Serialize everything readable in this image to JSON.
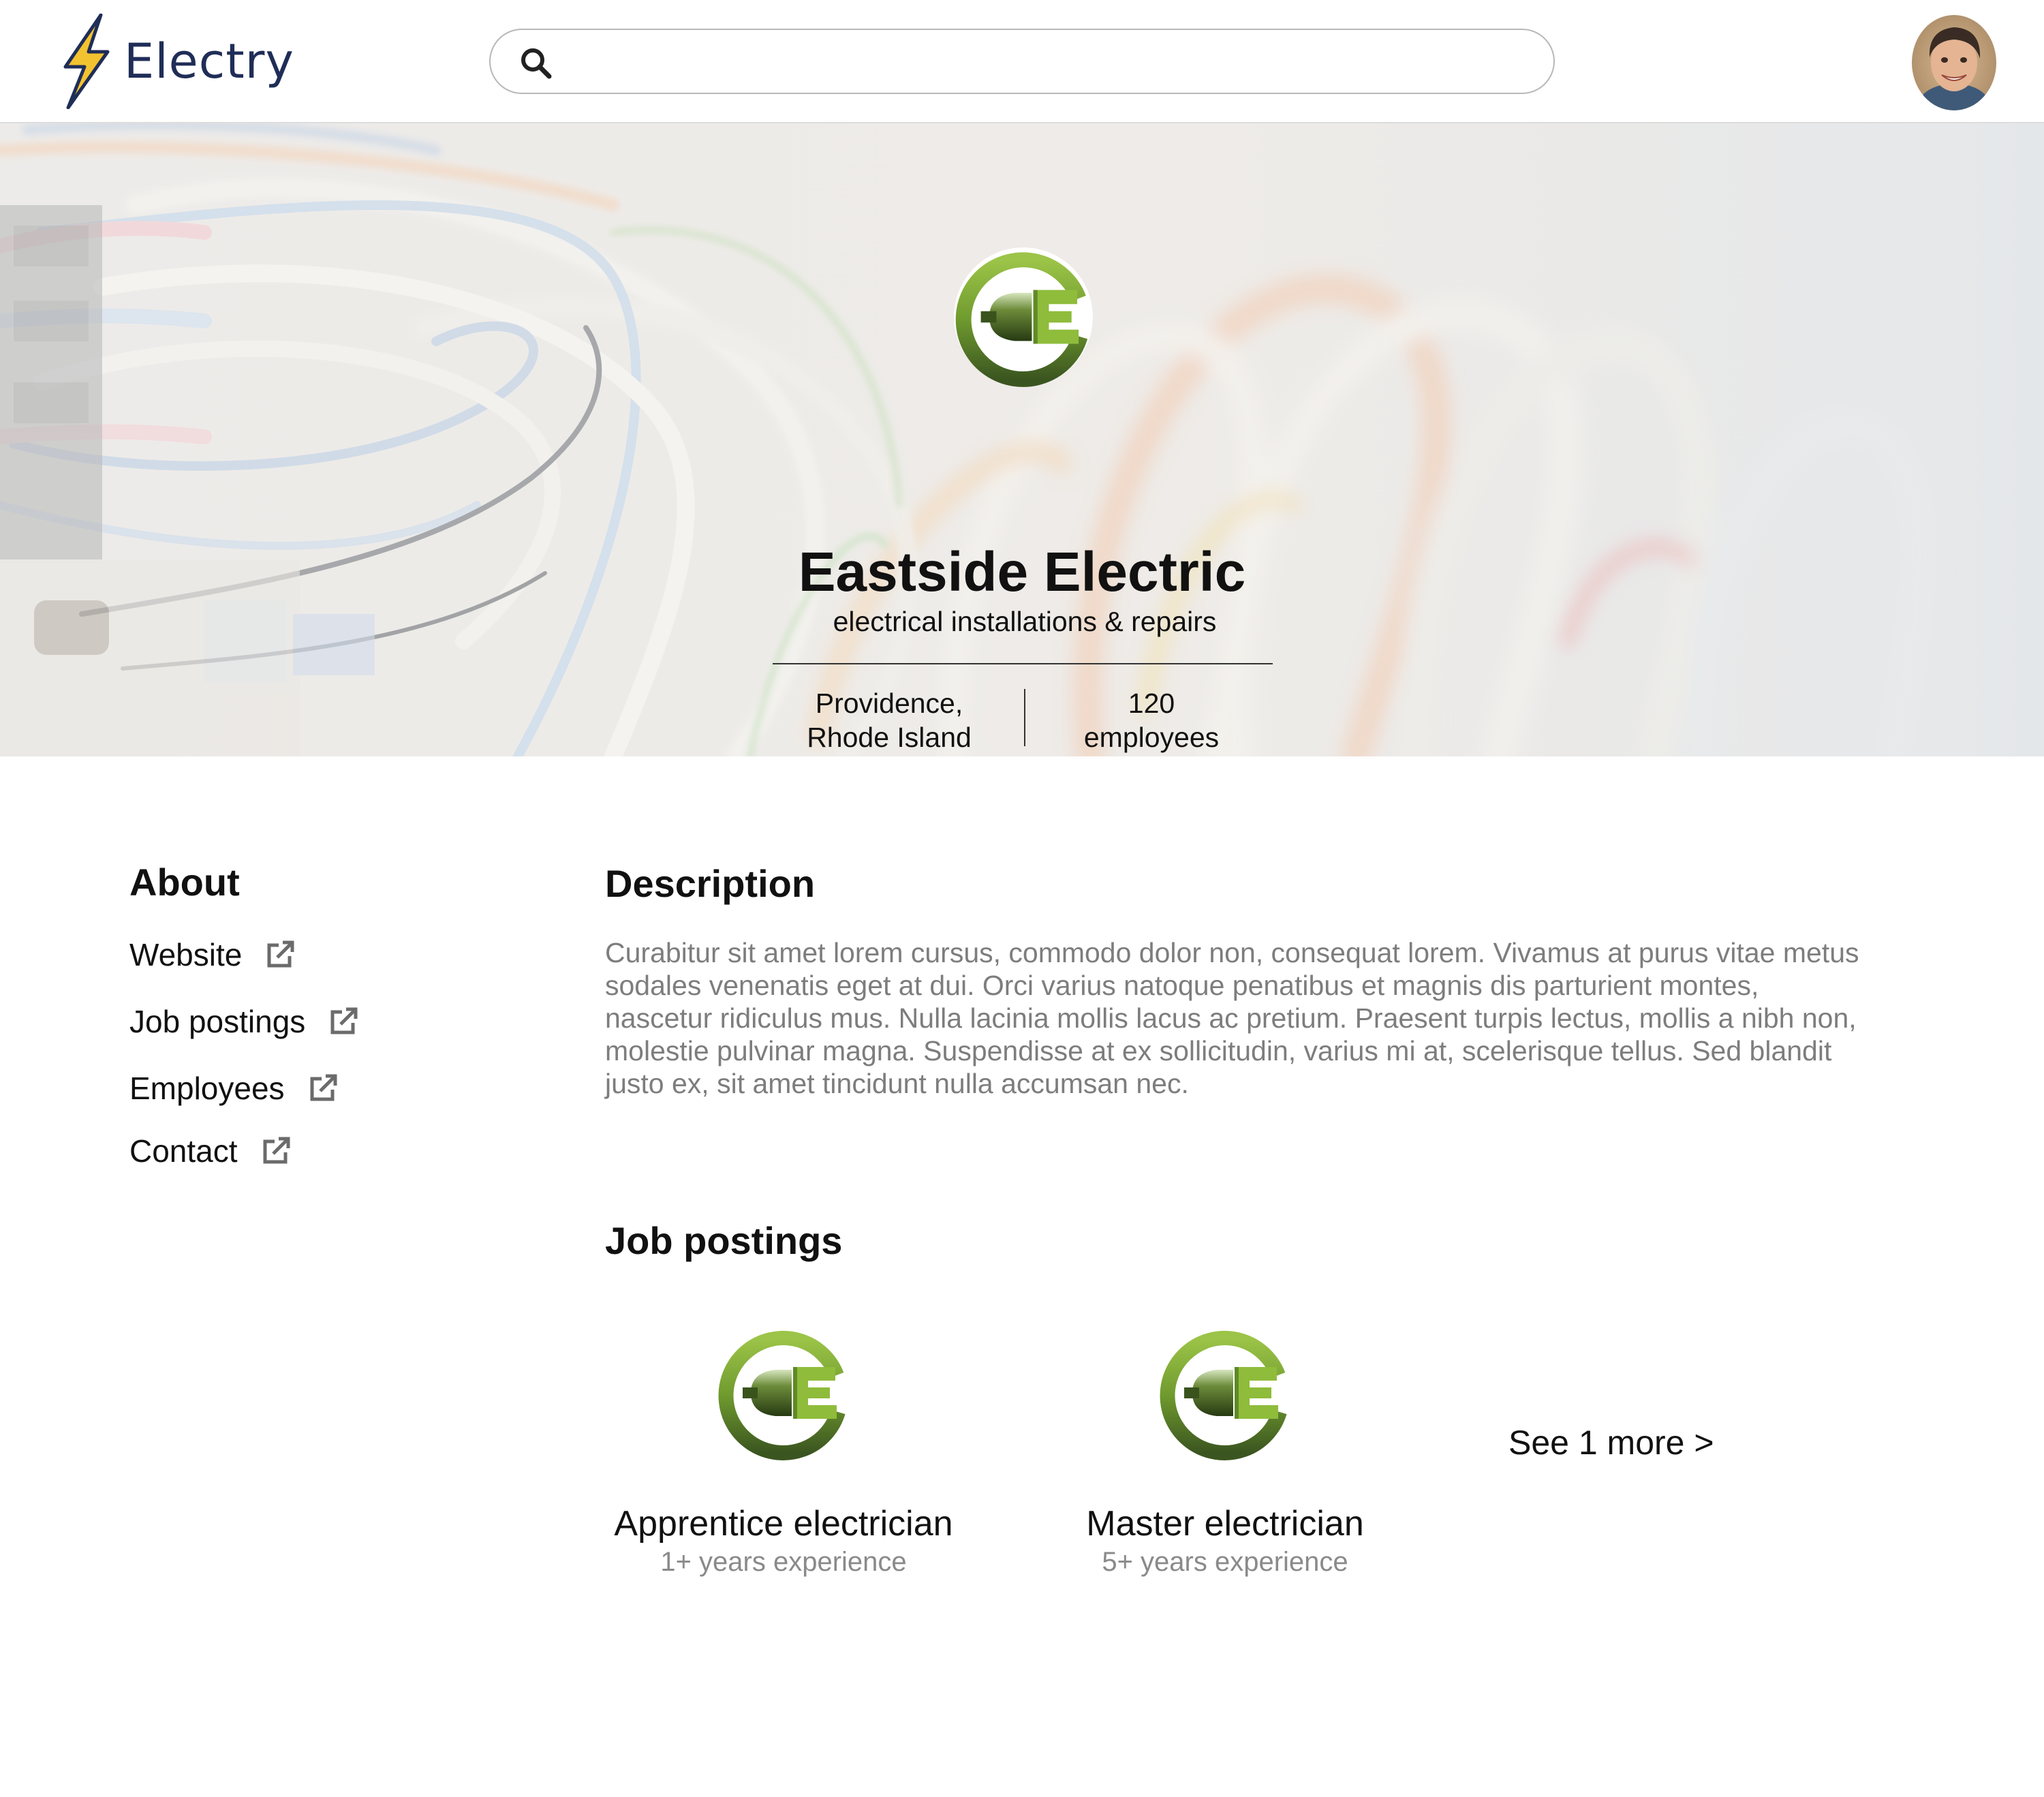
{
  "header": {
    "brand_name": "Electry",
    "search": {
      "value": "",
      "placeholder": ""
    }
  },
  "hero": {
    "company_name": "Eastside Electric",
    "tagline": "electrical installations & repairs",
    "location_line1": "Providence,",
    "location_line2": "Rhode Island",
    "employee_count": "120",
    "employee_label": "employees"
  },
  "about": {
    "heading": "About",
    "links": [
      {
        "label": "Website"
      },
      {
        "label": "Job postings"
      },
      {
        "label": "Employees"
      },
      {
        "label": "Contact"
      }
    ]
  },
  "description": {
    "heading": "Description",
    "text": "Curabitur sit amet lorem cursus, commodo dolor non, consequat lorem. Vivamus at purus vitae metus sodales venenatis eget at dui. Orci varius natoque penatibus et magnis dis parturient montes, nascetur ridiculus mus. Nulla lacinia mollis lacus ac pretium. Praesent turpis lectus, mollis a nibh non, molestie pulvinar magna. Suspendisse at ex sollicitudin, varius mi at, scelerisque tellus. Sed blandit justo ex, sit amet tincidunt nulla accumsan nec."
  },
  "jobs": {
    "heading": "Job postings",
    "items": [
      {
        "title": "Apprentice electrician",
        "experience": "1+ years experience"
      },
      {
        "title": "Master electrician",
        "experience": "5+ years experience"
      }
    ],
    "see_more": "See 1 more >"
  },
  "icons": {
    "brand": "lightning-bolt-icon",
    "search": "search-icon",
    "external_link": "external-link-icon",
    "company_logo": "eastside-electric-logo"
  },
  "colors": {
    "brand_navy": "#1f2d57",
    "bolt_yellow": "#f2c230",
    "logo_light_green": "#8db33a",
    "logo_dark_green": "#3f5a1f",
    "muted_text": "#7d7d7d"
  }
}
